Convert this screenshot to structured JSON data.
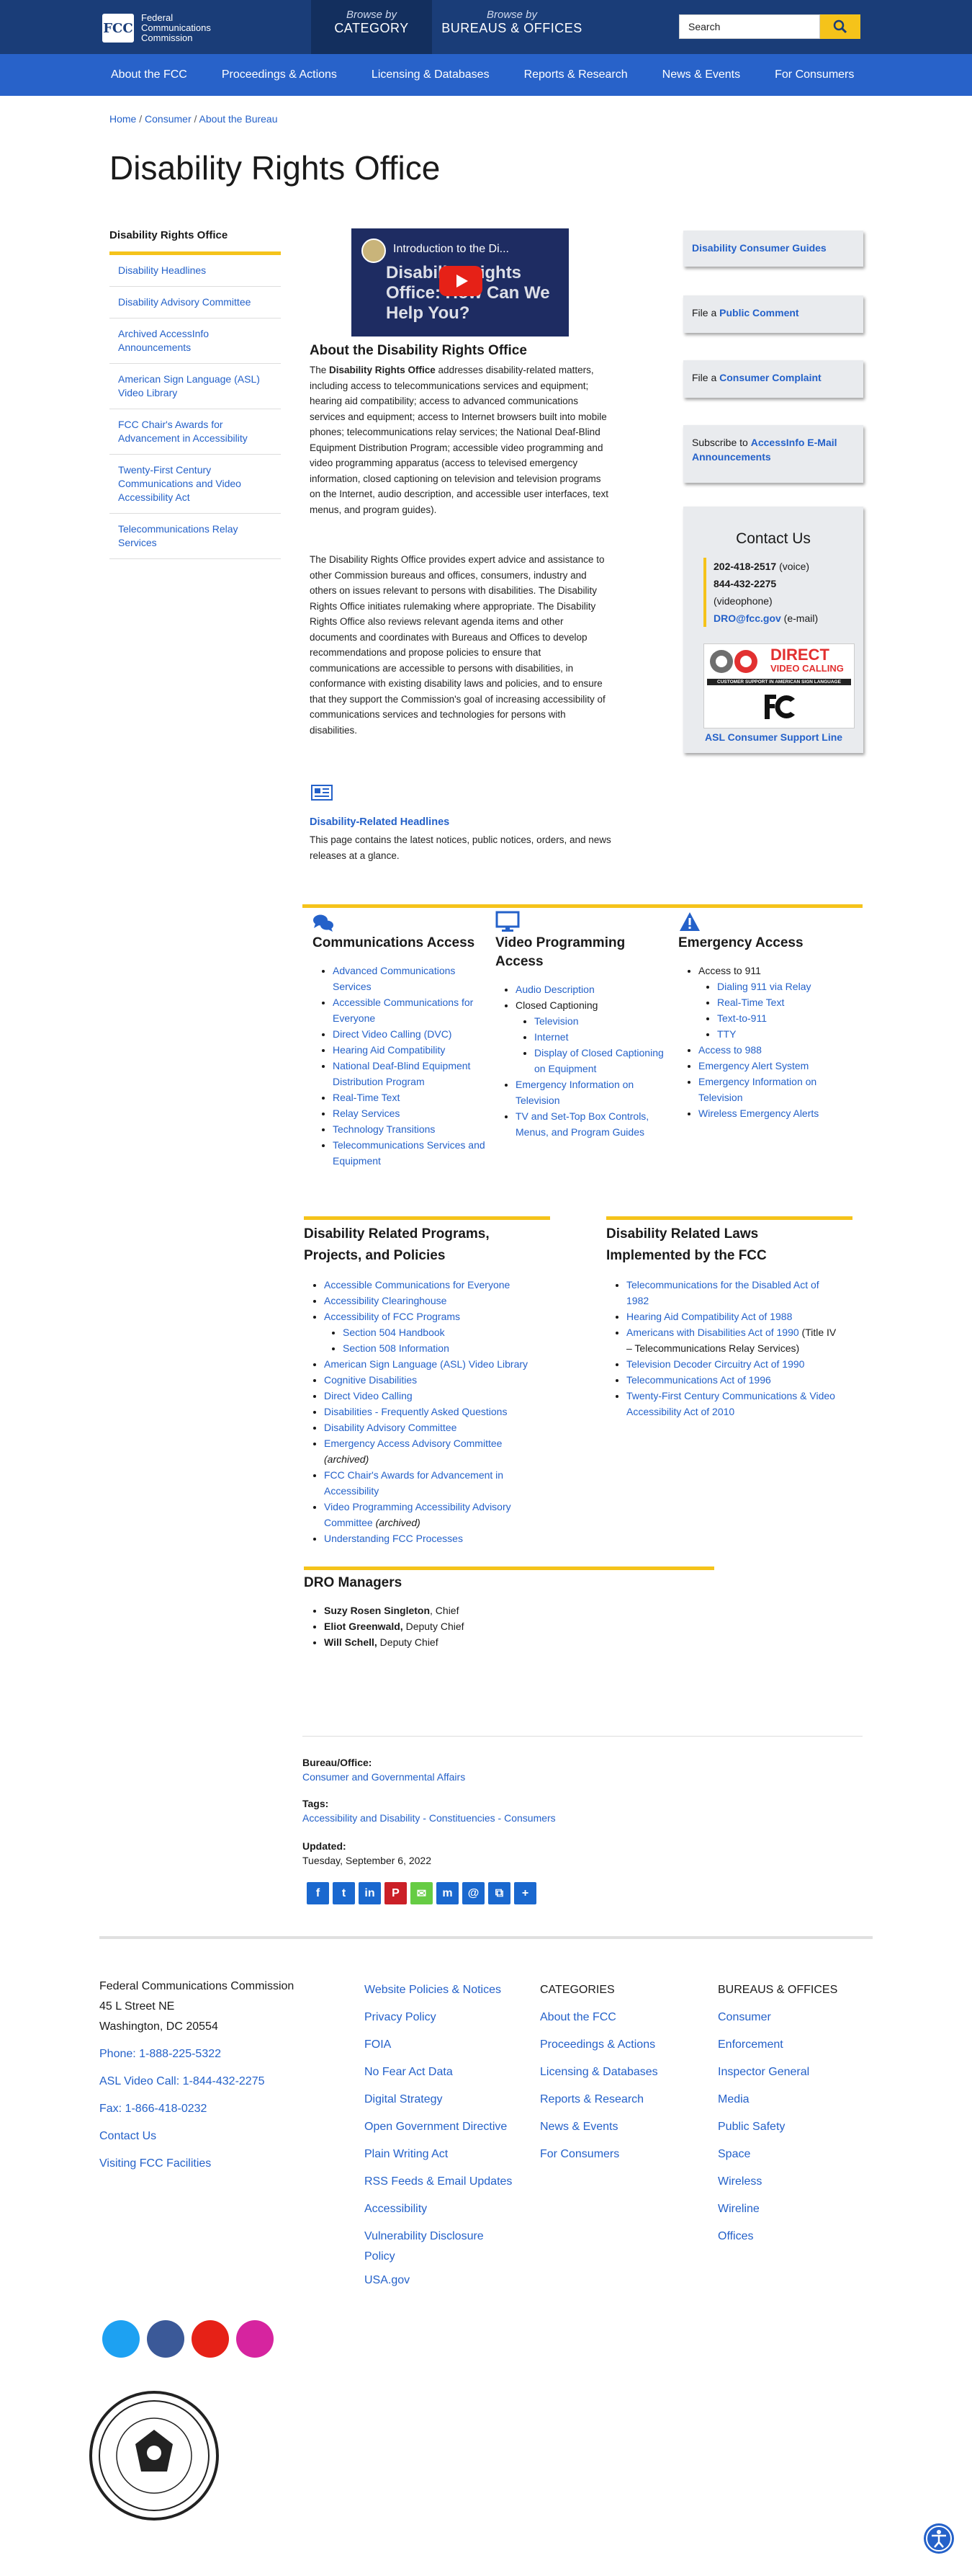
{
  "header": {
    "org_line1": "Federal",
    "org_line2": "Communications",
    "org_line3": "Commission",
    "browse_by": "Browse by",
    "category": "CATEGORY",
    "bureaus": "BUREAUS & OFFICES",
    "search_placeholder": "Search"
  },
  "nav": [
    "About the FCC",
    "Proceedings & Actions",
    "Licensing & Databases",
    "Reports & Research",
    "News & Events",
    "For Consumers"
  ],
  "breadcrumb": [
    "Home",
    "Consumer",
    "About the Bureau"
  ],
  "page_title": "Disability Rights Office",
  "left_nav": {
    "heading": "Disability Rights Office",
    "items": [
      "Disability Headlines",
      "Disability Advisory Committee",
      "Archived AccessInfo Announcements",
      "American Sign Language (ASL) Video Library",
      "FCC Chair's Awards for Advancement in Accessibility",
      "Twenty-First Century Communications and Video Accessibility Act",
      "Telecommunications Relay Services"
    ]
  },
  "video": {
    "title": "Introduction to the Di...",
    "overlay": "Disability Rights Office: How Can We Help You?"
  },
  "about": {
    "heading": "About the Disability Rights Office",
    "p1_lead": "The ",
    "p1_bold": "Disability Rights Office",
    "p1_rest": " addresses disability-related matters, including access to telecommunications services and equipment; hearing aid compatibility; access to advanced communications services and equipment; access to Internet browsers built into mobile phones; telecommunications relay services; the National Deaf-Blind Equipment Distribution Program; accessible video programming and video programming apparatus (access to televised emergency information, closed captioning on television and television programs on the Internet, audio description, and accessible user interfaces, text menus, and program guides).",
    "p2": "The Disability Rights Office provides expert advice and assistance to other Commission bureaus and offices, consumers, industry and others on issues relevant to persons with disabilities. The Disability Rights Office initiates rulemaking where appropriate. The Disability Rights Office also reviews relevant agenda items and other documents and coordinates with Bureaus and Offices to develop recommendations and propose policies to ensure that communications are accessible to persons with disabilities, in conformance with existing disability laws and policies, and to ensure that they support the Commission's goal of increasing accessibility of communications services and technologies for persons with disabilities."
  },
  "headlines": {
    "link": "Disability-Related Headlines",
    "desc": "This page contains the latest notices, public notices, orders, and news releases at a glance."
  },
  "right": {
    "guides": "Disability Consumer Guides",
    "comment_prefix": "File a ",
    "comment_link": "Public Comment",
    "complaint_prefix": "File a ",
    "complaint_link": "Consumer Complaint",
    "subscribe_prefix": "Subscribe to ",
    "subscribe_link": "AccessInfo E-Mail Announcements"
  },
  "contact": {
    "title": "Contact Us",
    "phone1": "202-418-2517",
    "phone1_note": " (voice)",
    "phone2": "844-432-2275",
    "phone2_note": "(videophone)",
    "email": "DRO@fcc.gov",
    "email_note": " (e-mail)",
    "dvc_title": "DIRECT",
    "dvc_title2": "VIDEO CALLING",
    "dvc_sub": "CUSTOMER SUPPORT IN AMERICAN SIGN LANGUAGE",
    "asl_link": "ASL Consumer Support Line"
  },
  "comm_access": {
    "title": "Communications Access",
    "items": [
      "Advanced Communications Services",
      "Accessible Communications for Everyone",
      "Direct Video Calling (DVC)",
      "Hearing Aid Compatibility",
      "National Deaf-Blind Equipment Distribution Program",
      "Real-Time Text",
      "Relay Services",
      "Technology Transitions",
      "Telecommunications Services and Equipment"
    ]
  },
  "video_access": {
    "title": "Video Programming Access",
    "audio": "Audio Description",
    "cc": "Closed Captioning",
    "cc_sub": [
      "Television",
      "Internet",
      "Display of Closed Captioning on Equipment"
    ],
    "items": [
      "Emergency Information on Television",
      "TV and Set-Top Box Controls, Menus, and Program Guides"
    ]
  },
  "emergency_access": {
    "title": "Emergency Access",
    "access911": "Access to 911",
    "sub911": [
      "Dialing 911 via Relay",
      "Real-Time Text",
      "Text-to-911",
      "TTY"
    ],
    "items": [
      "Access to 988",
      "Emergency Alert System",
      "Emergency Information on Television",
      "Wireless Emergency Alerts"
    ]
  },
  "programs": {
    "title": "Disability Related Programs, Projects, and Policies",
    "items_a": [
      "Accessible Communications for Everyone",
      "Accessibility Clearinghouse",
      "Accessibility of FCC Programs"
    ],
    "sub": [
      "Section 504 Handbook",
      "Section 508 Information"
    ],
    "items_b": [
      "American Sign Language (ASL) Video Library",
      "Cognitive Disabilities",
      "Direct Video Calling",
      "Disabilities - Frequently Asked Questions",
      "Disability Advisory Committee"
    ],
    "eaac": "Emergency Access Advisory Committee",
    "archived": "(archived)",
    "items_c": [
      "FCC Chair's Awards for Advancement in Accessibility"
    ],
    "vpaac": "Video Programming Accessibility Advisory Committee",
    "items_d": [
      "Understanding FCC Processes"
    ]
  },
  "laws": {
    "title": "Disability Related Laws Implemented by the FCC",
    "items_a": [
      "Telecommunications for the Disabled Act of 1982",
      "Hearing Aid Compatibility Act of 1988"
    ],
    "ada": "Americans with Disabilities Act of 1990",
    "ada_note": " (Title IV – Telecommunications Relay Services)",
    "items_b": [
      "Television Decoder Circuitry Act of 1990",
      "Telecommunications Act of 1996",
      "Twenty-First Century Communications & Video Accessibility Act of 2010"
    ]
  },
  "managers": {
    "title": "DRO Managers",
    "list": [
      {
        "name": "Suzy Rosen Singleton",
        "role": ", Chief"
      },
      {
        "name": "Eliot Greenwald,",
        "role": " Deputy Chief"
      },
      {
        "name": "Will Schell,",
        "role": " Deputy Chief"
      }
    ]
  },
  "meta": {
    "bureau_label": "Bureau/Office:",
    "bureau": "Consumer and Governmental Affairs",
    "tags_label": "Tags:",
    "tags": "Accessibility and Disability - Constituencies - Consumers",
    "updated_label": "Updated:",
    "updated": "Tuesday, September 6, 2022"
  },
  "footer": {
    "address": [
      "Federal Communications Commission",
      "45 L Street NE",
      "Washington, DC 20554"
    ],
    "phone": "Phone: 1-888-225-5322",
    "asl": "ASL Video Call: 1-844-432-2275",
    "fax": "Fax: 1-866-418-0232",
    "contact": "Contact Us",
    "visit": "Visiting FCC Facilities",
    "policies": [
      "Website Policies & Notices",
      "Privacy Policy",
      "FOIA",
      "No Fear Act Data",
      "Digital Strategy",
      "Open Government Directive",
      "Plain Writing Act",
      "RSS Feeds & Email Updates",
      "Accessibility",
      "Vulnerability Disclosure",
      "Policy",
      "USA.gov"
    ],
    "cat_head": "CATEGORIES",
    "categories": [
      "About the FCC",
      "Proceedings & Actions",
      "Licensing & Databases",
      "Reports & Research",
      "News & Events",
      "For Consumers"
    ],
    "bur_head": "BUREAUS & OFFICES",
    "bureaus": [
      "Consumer",
      "Enforcement",
      "Inspector General",
      "Media",
      "Public Safety",
      "Space",
      "Wireless",
      "Wireline",
      "Offices"
    ]
  },
  "colors": {
    "navy": "#1a3d78",
    "blue": "#2862c9",
    "gold": "#f5c31a",
    "link": "#2461c9"
  }
}
